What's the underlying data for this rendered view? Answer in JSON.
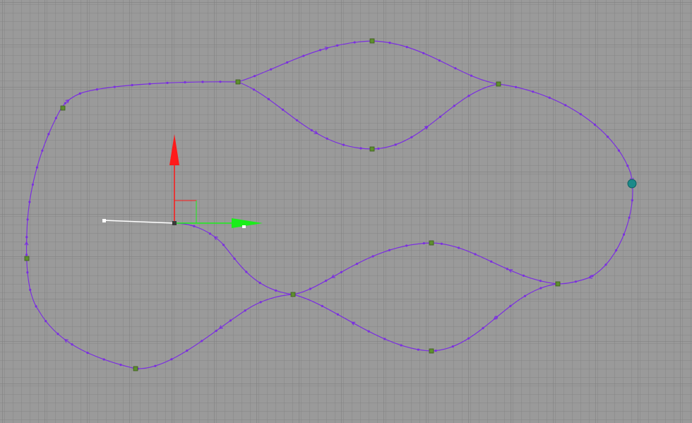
{
  "viewport": {
    "background": "#9a9a9a",
    "grid_minor_color": "#858585",
    "grid_major_color": "#7c7c7c"
  },
  "path": {
    "color": "#7b2fe0",
    "control_point_color": "#5e8f2e",
    "selected_node_color": "#1c8a8a",
    "direction": "clockwise"
  },
  "gizmo": {
    "x_axis_color": "#ff1a1a",
    "y_axis_color": "#1aee1a",
    "z_axis_color": "#ffffff"
  }
}
